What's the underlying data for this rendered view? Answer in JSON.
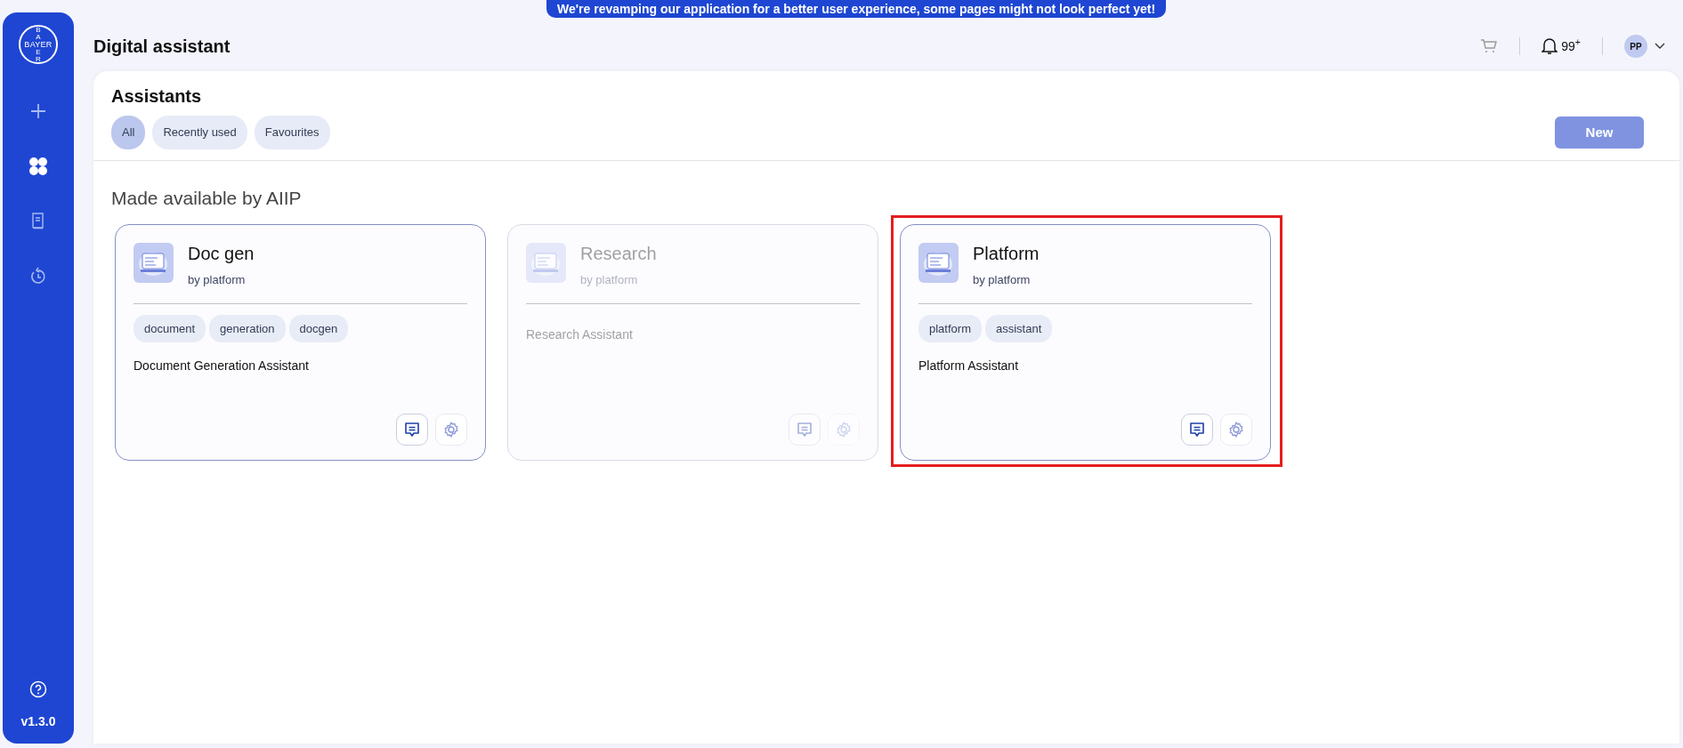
{
  "banner": "We're revamping our application for a better user experience, some pages might not look perfect yet!",
  "logo": {
    "top": "BA",
    "horizontal": "BAYER",
    "bottom": "ER"
  },
  "sidebar": {
    "items": [
      {
        "kind": "plus",
        "selected": false
      },
      {
        "kind": "grid",
        "selected": true
      },
      {
        "kind": "book",
        "selected": false
      },
      {
        "kind": "history",
        "selected": false
      }
    ],
    "version": "v1.3.0"
  },
  "header": {
    "title": "Digital assistant",
    "notifications": "99$^{+}$",
    "avatar": "PP"
  },
  "panel": {
    "title": "Assistants",
    "filters": [
      {
        "label": "All",
        "selected": true
      },
      {
        "label": "Recently used",
        "selected": false
      },
      {
        "label": "Favourites",
        "selected": false
      }
    ],
    "new_button": {
      "label": "New",
      "disabled": true
    }
  },
  "section": {
    "title": "Made available by AIIP"
  },
  "assistants": [
    {
      "name": "Doc gen",
      "author": "by platform",
      "tags": [
        "document",
        "generation",
        "docgen"
      ],
      "description": "Document Generation Assistant",
      "disabled": false,
      "highlighted": false
    },
    {
      "name": "Research",
      "author": "by platform",
      "description": "Research Assistant",
      "disabled": true,
      "highlighted": false
    },
    {
      "name": "Platform",
      "author": "by platform",
      "tags": [
        "platform",
        "assistant"
      ],
      "description": "Platform Assistant",
      "disabled": false,
      "highlighted": true
    }
  ]
}
